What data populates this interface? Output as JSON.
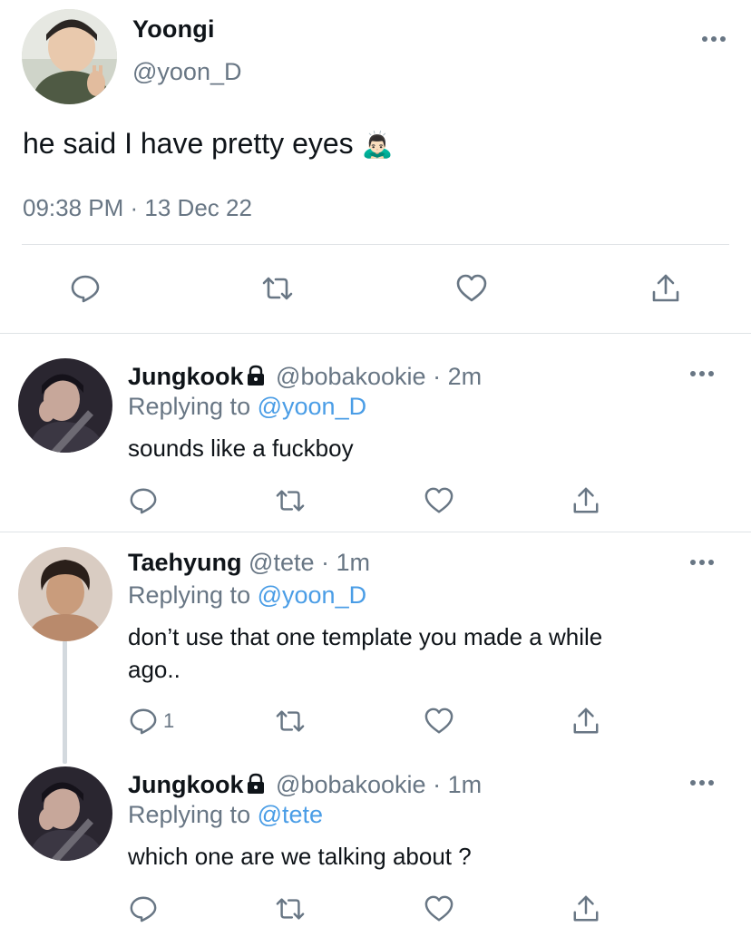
{
  "main_tweet": {
    "name": "Yoongi",
    "handle": "@yoon_D",
    "text": "he said I have pretty eyes",
    "emoji": "🙇🏻‍♂️",
    "timestamp": "09:38 PM · 13 Dec 22"
  },
  "replies": [
    {
      "name": "Jungkook",
      "handle": "@bobakookie",
      "time": "· 2m",
      "replying_prefix": "Replying to",
      "replying_to": "@yoon_D",
      "text": "sounds like a fuckboy",
      "reply_count": ""
    },
    {
      "name": "Taehyung",
      "handle": "@tete",
      "time": "· 1m",
      "replying_prefix": "Replying to",
      "replying_to": "@yoon_D",
      "text_line1": "don’t use that one template you made a while",
      "text_line2": "ago..",
      "reply_count": "1"
    },
    {
      "name": "Jungkook",
      "handle": "@bobakookie",
      "time": "· 1m",
      "replying_prefix": "Replying to",
      "replying_to": "@tete",
      "text": "which one are we talking about ?",
      "reply_count": ""
    }
  ],
  "icons": {
    "reply": "reply-icon",
    "retweet": "retweet-icon",
    "like": "heart-icon",
    "share": "share-icon",
    "more": "more-options-icon",
    "lock": "lock-icon"
  },
  "colors": {
    "text": "#0f1419",
    "muted": "#687684",
    "link": "#4a9de6",
    "divider": "#dfe3e6"
  }
}
